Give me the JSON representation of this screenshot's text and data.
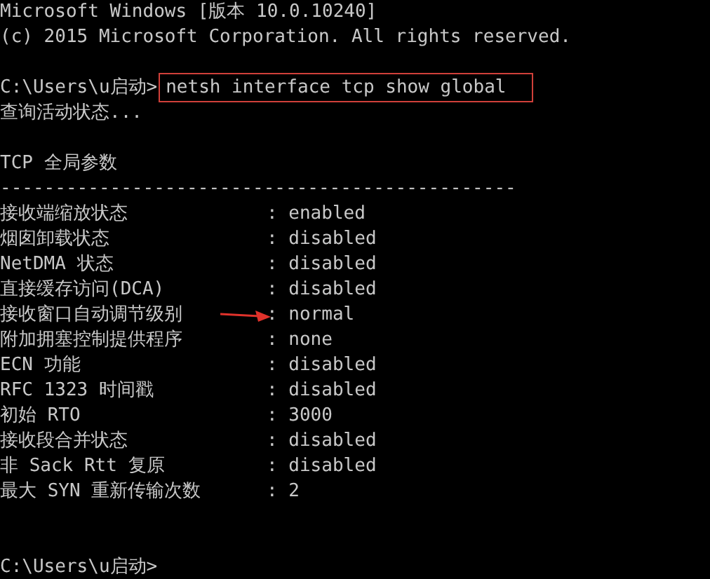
{
  "console": {
    "header_lines": [
      "Microsoft Windows [版本 10.0.10240]",
      "(c) 2015 Microsoft Corporation. All rights reserved."
    ],
    "prompt": "C:\\Users\\u启动>",
    "command": {
      "text": "netsh interface tcp show global",
      "highlighted": true
    },
    "status": "查询活动状态...",
    "section_title": "TCP 全局参数",
    "separator": "-----------------------------------------------",
    "params": [
      {
        "label": "接收端缩放状态",
        "value": ": enabled",
        "annotated": false
      },
      {
        "label": "烟囱卸载状态",
        "value": ": disabled",
        "annotated": false
      },
      {
        "label": "NetDMA 状态",
        "value": ": disabled",
        "annotated": false
      },
      {
        "label": "直接缓存访问(DCA)",
        "value": ": disabled",
        "annotated": false
      },
      {
        "label": "接收窗口自动调节级别",
        "value": ": normal",
        "annotated": true
      },
      {
        "label": "附加拥塞控制提供程序",
        "value": ": none",
        "annotated": false
      },
      {
        "label": "ECN 功能",
        "value": ": disabled",
        "annotated": false
      },
      {
        "label": "RFC 1323 时间戳",
        "value": ": disabled",
        "annotated": false
      },
      {
        "label": "初始 RTO",
        "value": ": 3000",
        "annotated": false
      },
      {
        "label": "接收段合并状态",
        "value": ": disabled",
        "annotated": false
      },
      {
        "label": "非 Sack Rtt 复原",
        "value": ": disabled",
        "annotated": false
      },
      {
        "label": "最大 SYN 重新传输次数",
        "value": ": 2",
        "annotated": false
      }
    ],
    "final_prompt": "C:\\Users\\u启动>"
  }
}
